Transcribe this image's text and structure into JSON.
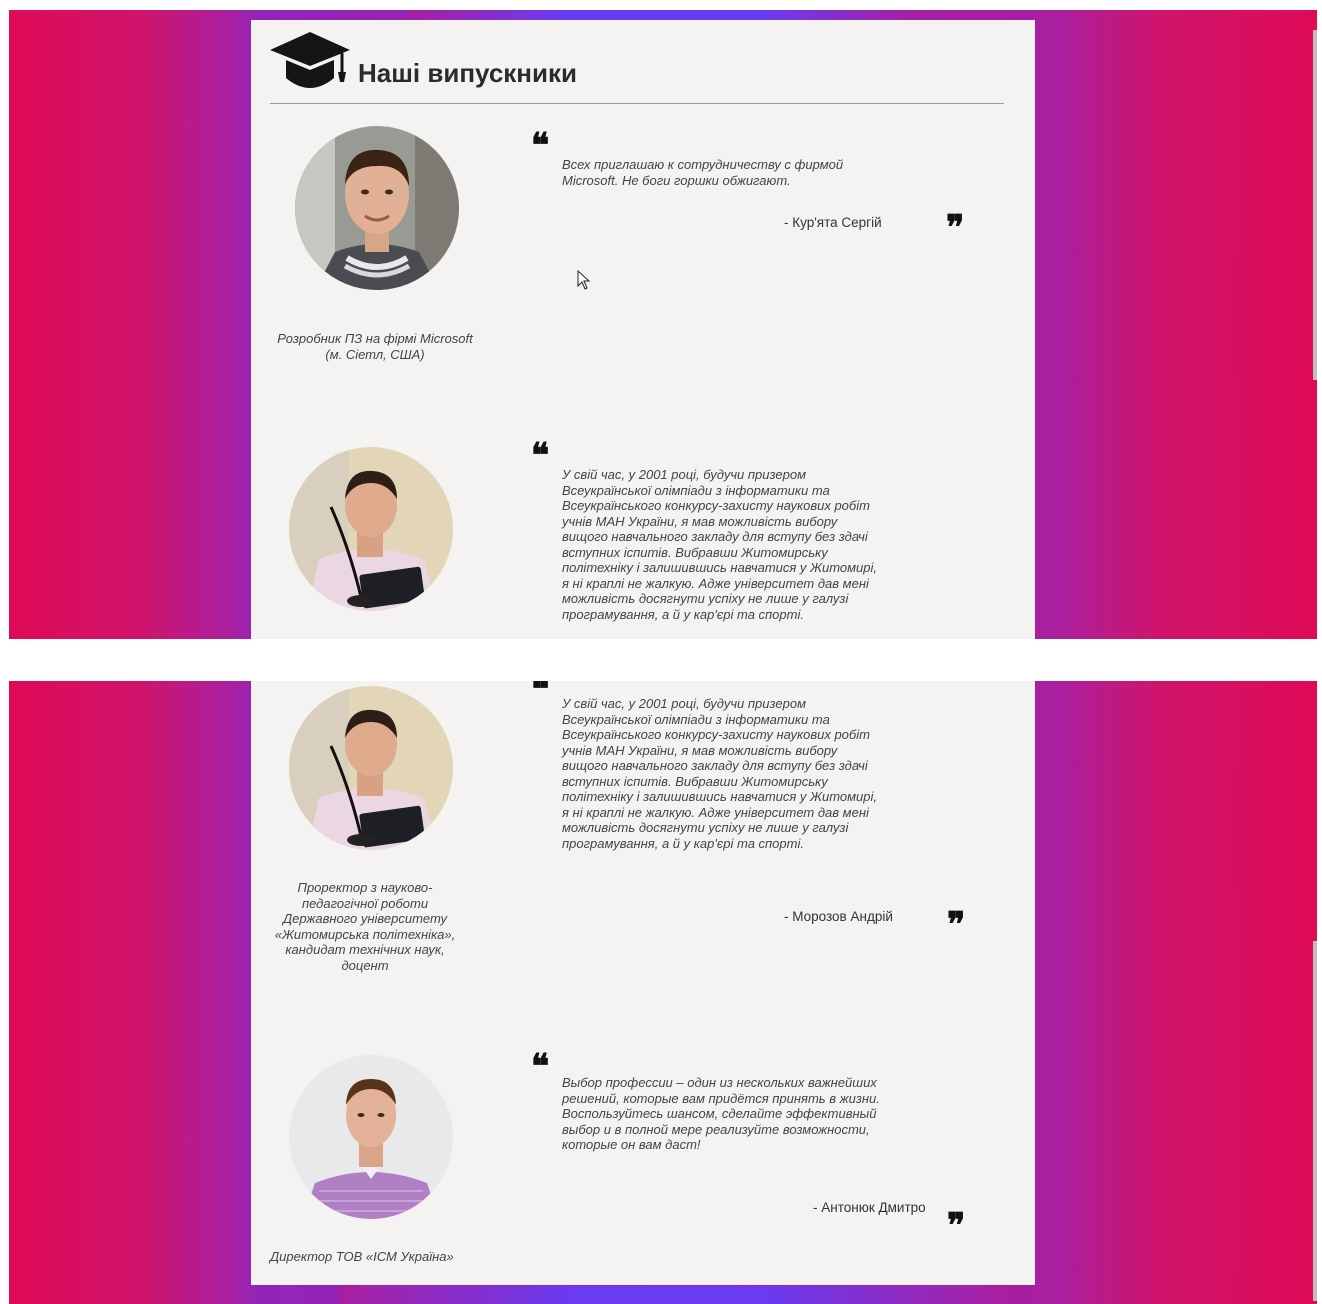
{
  "section": {
    "title": "Наші випускники"
  },
  "testimonials": [
    {
      "quote": "Всех приглашаю к сотрудничеству с фирмой Microsoft. Не боги горшки обжигают.",
      "author": "- Кур'ята Сергій",
      "role": "Розробник ПЗ на фірмі Microsoft (м. Сіетл, США)"
    },
    {
      "quote": "У свій час, у 2001 році, будучи призером Всеукраїнської олімпіади з інформатики та Всеукраїнського конкурсу-захисту наукових робіт учнів МАН України, я мав можливість вибору вищого навчального закладу для вступу без здачі вступних іспитів. Вибравши Житомирську політехніку і залишившись навчатися у Житомирі, я ні краплі не жалкую. Адже університет дав мені можливість досягнути успіху не лише у галузі програмування, а й у кар'єрі та спорті.",
      "author": "- Морозов Андрій",
      "role": "Проректор з науково-педагогічної роботи Державного університету «Житомирська політехніка», кандидат технічних наук, доцент"
    },
    {
      "quote": "Выбор профессии – один из нескольких важнейших решений, которые вам придётся принять в жизни. Воспользуйтесь шансом, сделайте эффективный выбор и в полной мере реализуйте возможности, которые он вам даст!",
      "author": "- Антонюк Дмитро",
      "role": "Директор ТОВ «ІСМ Україна»"
    }
  ],
  "glyphs": {
    "open_quote": "❝",
    "close_quote": "❞"
  },
  "icons": [
    "graduation-cap-icon",
    "mouse-cursor-icon"
  ],
  "colors": {
    "background_pink": "#df0a56",
    "background_purple": "#9225b9",
    "panel": "#f4f3f1",
    "accent_blue": "#6a3bf0"
  }
}
